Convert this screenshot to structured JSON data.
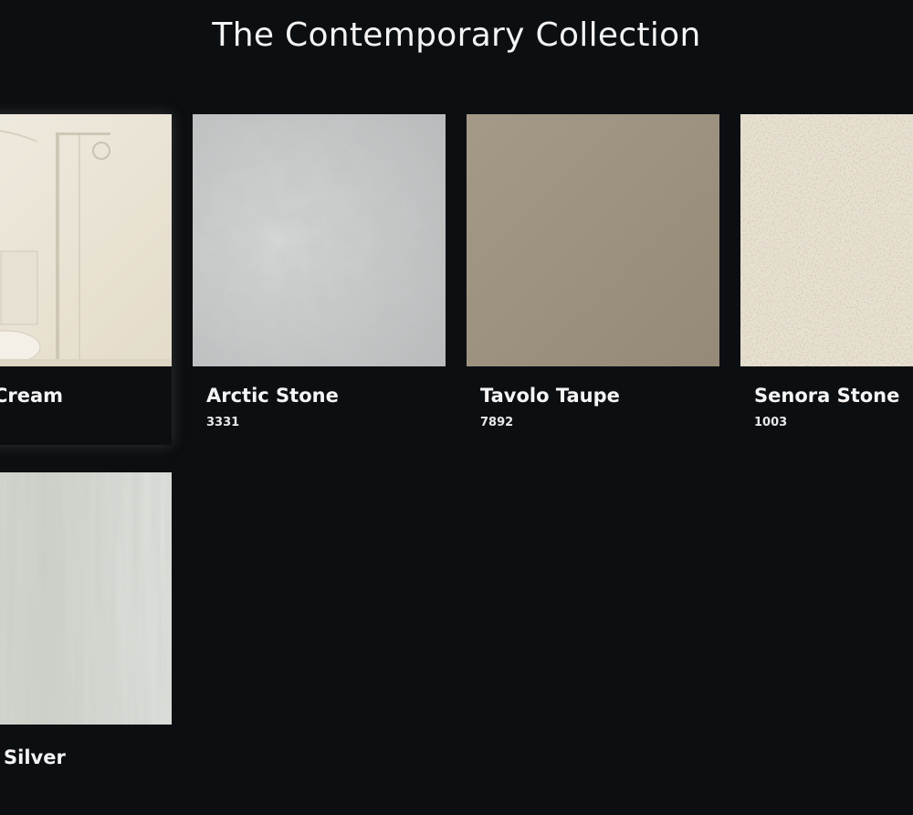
{
  "page": {
    "title": "The Contemporary Collection"
  },
  "products": [
    {
      "name": "Cream",
      "code": "",
      "swatch": "cream-bathroom"
    },
    {
      "name": "Arctic Stone",
      "code": "3331",
      "swatch": "arctic-stone"
    },
    {
      "name": "Tavolo Taupe",
      "code": "7892",
      "swatch": "tavolo-taupe"
    },
    {
      "name": "Senora Stone",
      "code": "1003",
      "swatch": "senora-stone"
    },
    {
      "name": "Silver",
      "code": "",
      "swatch": "silver-marble"
    }
  ],
  "colors": {
    "background": "#0c0f12",
    "cream": "#ece6d8",
    "arctic": "#c9cccc",
    "taupe": "#9c8f7c",
    "senora": "#e6dfcf",
    "silver": "#d6d9d4"
  }
}
